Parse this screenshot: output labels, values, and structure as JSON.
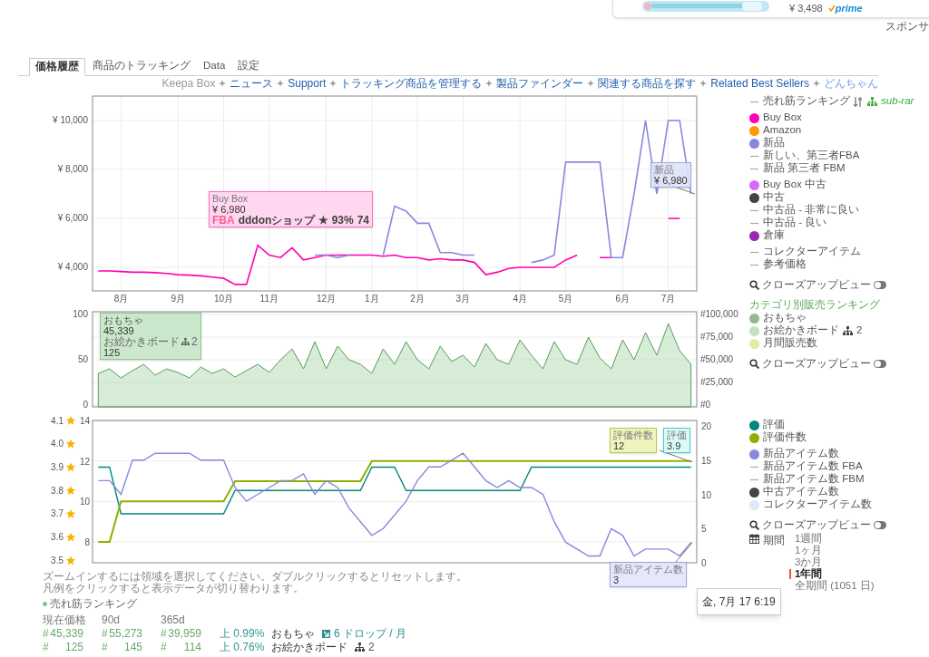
{
  "ad": {
    "price": "¥ 3,498",
    "badge": "prime",
    "label": "スポンサ"
  },
  "tabs": [
    {
      "label": "価格履歴",
      "selected": true
    },
    {
      "label": "商品のトラッキング",
      "selected": false
    },
    {
      "label": "Data",
      "selected": false
    },
    {
      "label": "設定",
      "selected": false
    }
  ],
  "links": [
    {
      "label": "Keepa Box",
      "kind": "muted"
    },
    {
      "label": "ニュース",
      "kind": "link"
    },
    {
      "label": "Support",
      "kind": "link"
    },
    {
      "label": "トラッキング商品を管理する",
      "kind": "link"
    },
    {
      "label": "製品ファインダー",
      "kind": "link"
    },
    {
      "label": "関連する商品を探す",
      "kind": "link"
    },
    {
      "label": "Related Best Sellers",
      "kind": "link"
    },
    {
      "label": "どんちゃん",
      "kind": "user"
    }
  ],
  "price_chart": {
    "chart_data": {
      "type": "line",
      "grid": true,
      "categories": [
        null,
        null,
        "8月",
        null,
        null,
        null,
        null,
        "9月",
        null,
        null,
        null,
        "10月",
        null,
        null,
        null,
        "11月",
        null,
        null,
        null,
        null,
        "12月",
        null,
        null,
        null,
        "1月",
        null,
        null,
        null,
        "2月",
        null,
        null,
        null,
        "3月",
        null,
        null,
        null,
        null,
        "4月",
        null,
        null,
        null,
        "5月",
        null,
        null,
        null,
        null,
        "6月",
        null,
        null,
        null,
        "7月",
        null,
        null
      ],
      "ylim": [
        3037,
        11000
      ],
      "yticks": [
        {
          "value": 4000,
          "label": "¥ 4,000"
        },
        {
          "value": 6000,
          "label": "¥ 6,000"
        },
        {
          "value": 8000,
          "label": "¥ 8,000"
        },
        {
          "value": 10000,
          "label": "¥ 10,000"
        }
      ],
      "series": [
        {
          "color": "#ff00b4",
          "values": [
            3850,
            3850,
            3830,
            3800,
            3800,
            3780,
            3750,
            3700,
            3680,
            3650,
            3600,
            3550,
            3300,
            3300,
            4900,
            4500,
            4400,
            4800,
            4300,
            4400,
            4500,
            4500,
            4500,
            4500,
            4500,
            4450,
            4500,
            4400,
            4400,
            4300,
            4350,
            4300,
            4300,
            4200,
            3700,
            3800,
            3950,
            4000,
            4000,
            4000,
            4000,
            4300,
            4500,
            null,
            4400,
            4400,
            null,
            null,
            null,
            null,
            6000,
            6000,
            null
          ]
        },
        {
          "color": "#8888dd",
          "values": [
            null,
            null,
            null,
            null,
            null,
            null,
            null,
            null,
            null,
            null,
            null,
            null,
            null,
            null,
            null,
            null,
            null,
            null,
            null,
            4500,
            4500,
            4400,
            4500,
            null,
            null,
            4500,
            6500,
            6300,
            5800,
            5800,
            4600,
            4600,
            4500,
            4500,
            null,
            null,
            null,
            null,
            4200,
            4300,
            4500,
            8300,
            8300,
            8300,
            8300,
            4400,
            4400,
            7000,
            10000,
            7000,
            10000,
            10000,
            7000
          ]
        }
      ]
    },
    "tooltips": [
      {
        "kind": "new",
        "title": "新品",
        "value": "¥ 6,980"
      },
      {
        "kind": "buybox",
        "title": "Buy Box",
        "value": "¥ 6,980",
        "fulfillment": "FBA",
        "seller": "dddonショップ",
        "rating": "★ 93%",
        "count": "74"
      }
    ]
  },
  "rank_chart": {
    "chart_data": {
      "type": "area",
      "grid": true,
      "categories": [
        null,
        null,
        null,
        null,
        null,
        null,
        null,
        null,
        null,
        null,
        null,
        null,
        null,
        null,
        null,
        null,
        null,
        null,
        null,
        null,
        null,
        null,
        null,
        null,
        null,
        null,
        null,
        null,
        null,
        null,
        null,
        null,
        null,
        null,
        null,
        null,
        null,
        null,
        null,
        null,
        null,
        null,
        null,
        null,
        null,
        null,
        null,
        null,
        null,
        null,
        null,
        null,
        null
      ],
      "ylim": [
        -2000,
        103000
      ],
      "yticks": [
        {
          "value": 0,
          "label": "#0"
        },
        {
          "value": 25000,
          "label": "#25,000"
        },
        {
          "value": 50000,
          "label": "#50,000"
        },
        {
          "value": 75000,
          "label": "#75,000"
        },
        {
          "value": 100000,
          "label": "#100,000"
        }
      ],
      "y2lim": [
        -2,
        103
      ],
      "y2ticks": [
        {
          "value": 0,
          "label": "0"
        },
        {
          "value": 50,
          "label": "50"
        },
        {
          "value": 100,
          "label": "100"
        }
      ],
      "series": [
        {
          "color": "#5a9a5a",
          "values": [
            35000,
            40000,
            30000,
            38000,
            45000,
            33000,
            40000,
            36000,
            30000,
            42000,
            35000,
            40000,
            31000,
            38000,
            45000,
            36000,
            50000,
            62000,
            40000,
            70000,
            40000,
            65000,
            50000,
            45000,
            35000,
            62000,
            45000,
            70000,
            50000,
            40000,
            65000,
            48000,
            55000,
            42000,
            68000,
            50000,
            45000,
            72000,
            55000,
            40000,
            70000,
            50000,
            45000,
            75000,
            52000,
            40000,
            72000,
            50000,
            80000,
            55000,
            90000,
            60000,
            45000
          ]
        }
      ]
    },
    "tooltip": {
      "title": "おもちゃ",
      "value": "45,339",
      "subtitle": "お絵かきボード",
      "subcount": "2",
      "subvalue": "125"
    }
  },
  "rating_chart": {
    "chart_data": {
      "type": "line",
      "grid": true,
      "categories": [
        null,
        null,
        null,
        null,
        null,
        null,
        null,
        null,
        null,
        null,
        null,
        null,
        null,
        null,
        null,
        null,
        null,
        null,
        null,
        null,
        null,
        null,
        null,
        null,
        null,
        null,
        null,
        null,
        null,
        null,
        null,
        null,
        null,
        null,
        null,
        null,
        null,
        null,
        null,
        null,
        null,
        null,
        null,
        null,
        null,
        null,
        null,
        null,
        null,
        null,
        null,
        null,
        null
      ],
      "ylim": [
        0,
        20.8
      ],
      "yticks": [
        {
          "value": 0,
          "label": "0"
        },
        {
          "value": 5,
          "label": "5"
        },
        {
          "value": 10,
          "label": "10"
        },
        {
          "value": 15,
          "label": "15"
        },
        {
          "value": 20,
          "label": "20"
        }
      ],
      "y2lim": [
        3.49,
        4.1
      ],
      "y2ticks": [
        {
          "value": 3.5,
          "label": "3.5"
        },
        {
          "value": 3.6,
          "label": "3.6"
        },
        {
          "value": 3.7,
          "label": "3.7"
        },
        {
          "value": 3.8,
          "label": "3.8"
        },
        {
          "value": 3.9,
          "label": "3.9"
        },
        {
          "value": 4.0,
          "label": "4.0"
        },
        {
          "value": 4.1,
          "label": "4.1"
        }
      ],
      "y3lim": [
        6.97,
        14
      ],
      "y3ticks": [
        {
          "value": 8,
          "label": "8"
        },
        {
          "value": 10,
          "label": "10"
        },
        {
          "value": 12,
          "label": "12"
        },
        {
          "value": 14,
          "label": "14"
        }
      ],
      "series": [
        {
          "color": "#00897b",
          "axis": "y2",
          "values": [
            3.9,
            3.9,
            3.7,
            3.7,
            3.7,
            3.7,
            3.7,
            3.7,
            3.7,
            3.7,
            3.7,
            3.7,
            3.8,
            3.8,
            3.8,
            3.8,
            3.8,
            3.8,
            3.8,
            3.8,
            3.8,
            3.8,
            3.8,
            3.8,
            3.9,
            3.9,
            3.9,
            3.8,
            3.8,
            3.8,
            3.8,
            3.8,
            3.8,
            3.8,
            3.8,
            3.8,
            3.8,
            3.8,
            3.9,
            3.9,
            3.9,
            3.9,
            3.9,
            3.9,
            3.9,
            3.9,
            3.9,
            3.9,
            3.9,
            3.9,
            3.9,
            3.9,
            3.9
          ]
        },
        {
          "color": "#8fb000",
          "axis": "y3",
          "values": [
            8,
            8,
            10,
            10,
            10,
            10,
            10,
            10,
            10,
            10,
            10,
            10,
            11,
            11,
            11,
            11,
            11,
            11,
            11,
            11,
            11,
            11,
            11,
            11,
            12,
            12,
            12,
            12,
            12,
            12,
            12,
            12,
            12,
            12,
            12,
            12,
            12,
            12,
            12,
            12,
            12,
            12,
            12,
            12,
            12,
            12,
            12,
            12,
            12,
            12,
            12,
            12,
            12
          ]
        },
        {
          "color": "#8888dd",
          "values": [
            12,
            12,
            10,
            15,
            15,
            16,
            16,
            16,
            16,
            15,
            15,
            15,
            11,
            9,
            10,
            11,
            12,
            12,
            13,
            10,
            12,
            11,
            8,
            6,
            4,
            5,
            7,
            9,
            12,
            14,
            14,
            15,
            16,
            14,
            12,
            11,
            12,
            11,
            11,
            10,
            6,
            3,
            2,
            1,
            1,
            5,
            4,
            1,
            2,
            2,
            2,
            1,
            3
          ]
        }
      ]
    },
    "tooltips": [
      {
        "kind": "count",
        "title": "評価件数",
        "value": "12"
      },
      {
        "kind": "rating",
        "title": "評価",
        "value": "3.9"
      },
      {
        "kind": "items",
        "title": "新品アイテム数",
        "value": "3"
      }
    ],
    "date": "金, 7月 17 6:19"
  },
  "legends": [
    {
      "groups": [
        [
          {
            "label": "売れ筋ランキング",
            "kind": "dash",
            "tag": "sub-rar"
          }
        ],
        [
          {
            "label": "Buy Box",
            "kind": "dot",
            "color": "#ff00b4"
          },
          {
            "label": "Amazon",
            "kind": "dot",
            "color": "#ff9900"
          },
          {
            "label": "新品",
            "kind": "dot",
            "color": "#8888dd"
          },
          {
            "label": "新しい、第三者FBA",
            "kind": "dash"
          },
          {
            "label": "新品 第三者 FBM",
            "kind": "dash"
          }
        ],
        [
          {
            "label": "Buy Box 中古",
            "kind": "dot",
            "color": "#dd66ff"
          },
          {
            "label": "中古",
            "kind": "dot",
            "color": "#444444"
          },
          {
            "label": "中古品 - 非常に良い",
            "kind": "dash"
          },
          {
            "label": "中古品 - 良い",
            "kind": "dash"
          },
          {
            "label": "倉庫",
            "kind": "dot",
            "color": "#9c27b0"
          }
        ],
        [
          {
            "label": "コレクターアイテム",
            "kind": "dash"
          },
          {
            "label": "参考価格",
            "kind": "dash"
          }
        ]
      ],
      "closeup": {
        "label": "クローズアップビュー",
        "on": false
      }
    },
    {
      "groups": [
        [
          {
            "label": "カテゴリ別販売ランキング",
            "kind": "header"
          },
          {
            "label": "おもちゃ",
            "kind": "dot",
            "color": "#8fbc8f"
          },
          {
            "label": "お絵かきボード",
            "kind": "dot",
            "color": "#c2e0c2",
            "subcount": "2"
          },
          {
            "label": "月間販売数",
            "kind": "dot",
            "color": "#e6eba2"
          }
        ]
      ],
      "closeup": {
        "label": "クローズアップビュー",
        "on": false
      }
    },
    {
      "groups": [
        [
          {
            "label": "評価",
            "kind": "dot",
            "color": "#00897b"
          },
          {
            "label": "評価件数",
            "kind": "dot",
            "color": "#8fb000"
          }
        ],
        [
          {
            "label": "新品アイテム数",
            "kind": "dot",
            "color": "#8888dd"
          },
          {
            "label": "新品アイテム数 FBA",
            "kind": "dash"
          },
          {
            "label": "新品アイテム数 FBM",
            "kind": "dash"
          },
          {
            "label": "中古アイテム数",
            "kind": "dot",
            "color": "#444444"
          },
          {
            "label": "コレクターアイテム数",
            "kind": "dot",
            "color": "#dde8f8"
          }
        ]
      ],
      "closeup": {
        "label": "クローズアップビュー",
        "on": false
      },
      "period": {
        "label": "期間",
        "options": [
          {
            "label": "1週間",
            "selected": false
          },
          {
            "label": "1ヶ月",
            "selected": false
          },
          {
            "label": "3か月",
            "selected": false
          },
          {
            "label": "1年間",
            "selected": true
          },
          {
            "label": "全期間 (1051 日)",
            "selected": false
          }
        ]
      }
    }
  ],
  "notes": [
    "ズームインするには領域を選択してください。ダブルクリックするとリセットします。",
    "凡例をクリックすると表示データが切り替わります。"
  ],
  "summary": {
    "title": "売れ筋ランキング",
    "columns": [
      "現在価格",
      "90d",
      "365d"
    ],
    "rows": [
      {
        "kind": "drops",
        "cells": [
          {
            "sign": "#",
            "value": "45,339"
          },
          {
            "sign": "#",
            "value": "55,273"
          },
          {
            "sign": "#",
            "value": "39,959"
          }
        ],
        "change": "上 0.99%",
        "category": "おもちゃ",
        "trend": "6 ドロップ / 月"
      },
      {
        "kind": "subcategory",
        "cells": [
          {
            "sign": "#",
            "value": "125"
          },
          {
            "sign": "#",
            "value": "145"
          },
          {
            "sign": "#",
            "value": "114"
          }
        ],
        "change": "上 0.76%",
        "category": "お絵かきボード",
        "subcount": "2"
      }
    ]
  }
}
